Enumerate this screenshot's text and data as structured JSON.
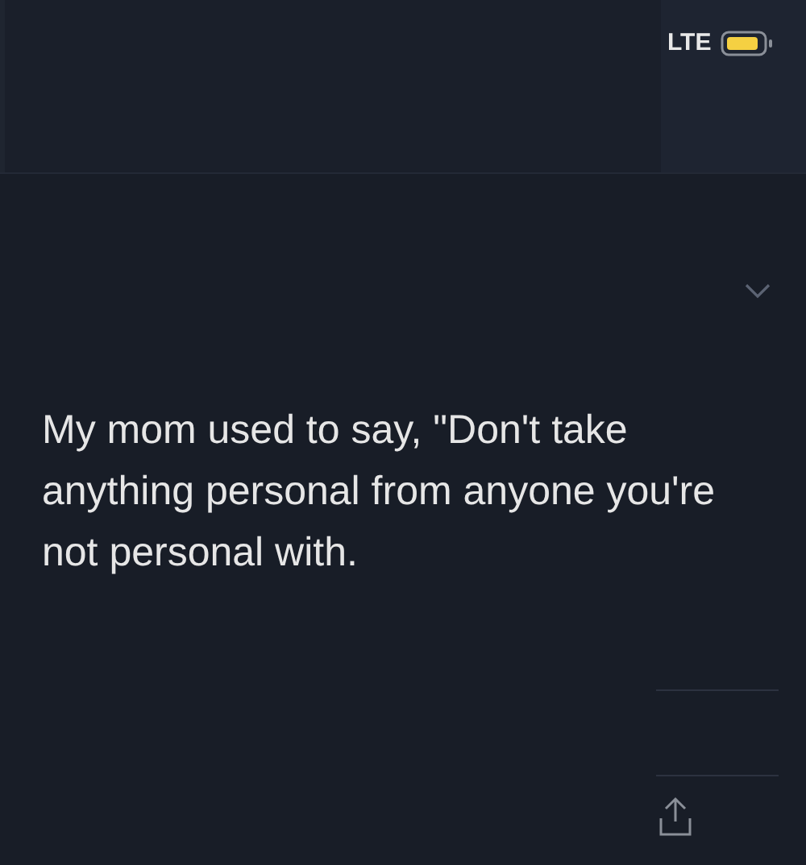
{
  "status_bar": {
    "network": "LTE"
  },
  "quote": {
    "text": "My mom used to say, \"Don't take anything personal from anyone you're not personal with."
  }
}
